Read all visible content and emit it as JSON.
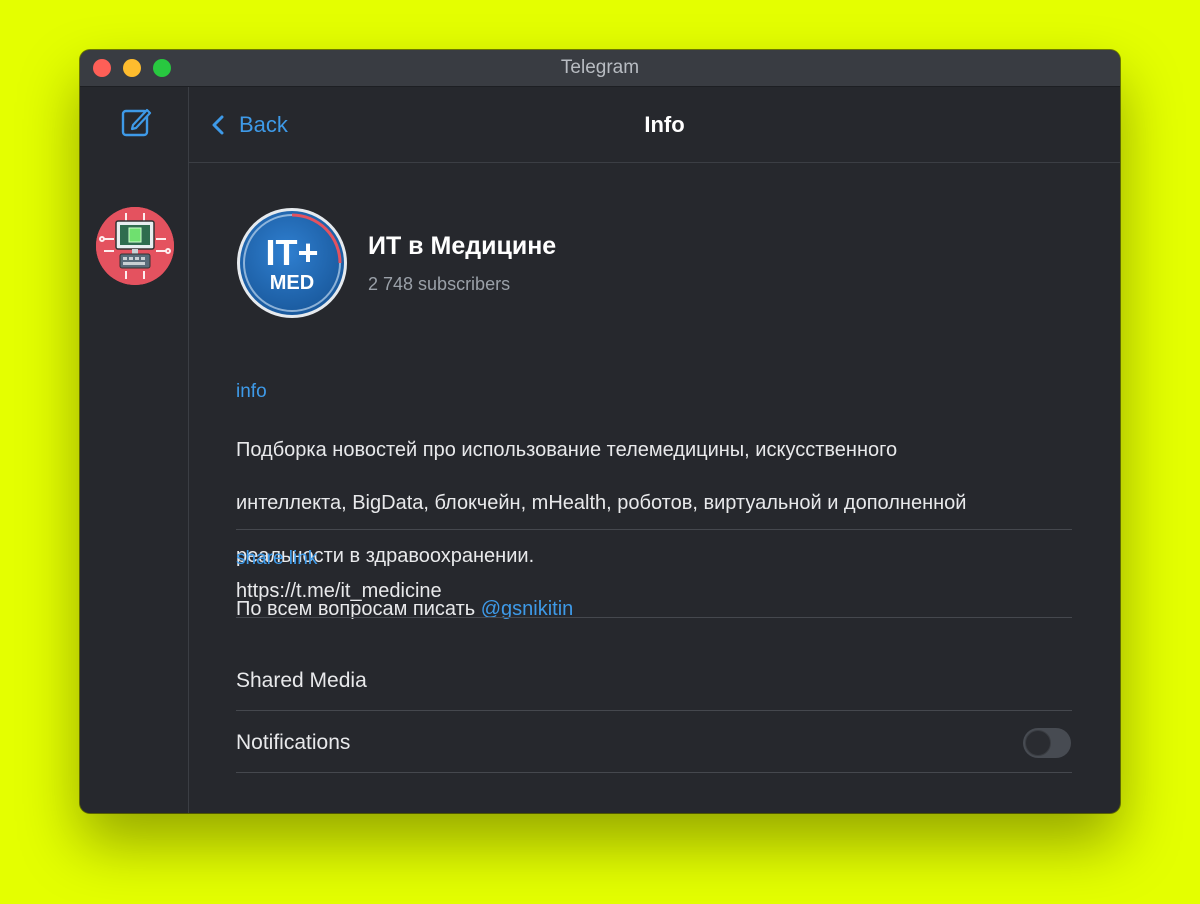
{
  "window": {
    "title": "Telegram"
  },
  "header": {
    "back_label": "Back",
    "title": "Info"
  },
  "channel": {
    "name": "ИТ в Медицине",
    "subscribers": "2 748 subscribers",
    "avatar_text_top": "IT+",
    "avatar_text_bottom": "MED"
  },
  "info": {
    "label": "info",
    "description_lines": [
      "Подборка новостей про использование телемедицины,  искусственного",
      "интеллекта, BigData, блокчейн, mHealth, роботов, виртуальной и дополненной",
      "реальности в здравоохранении."
    ],
    "contact_prefix": "По всем вопросам писать ",
    "contact_handle": "@gsnikitin"
  },
  "share": {
    "label": "share link",
    "url": "https://t.me/it_medicine"
  },
  "shared_media": {
    "label": "Shared Media"
  },
  "notifications": {
    "label": "Notifications",
    "enabled": false
  },
  "colors": {
    "accent": "#3e9ae8",
    "background": "#26282d",
    "desktop": "#e4ff00"
  }
}
